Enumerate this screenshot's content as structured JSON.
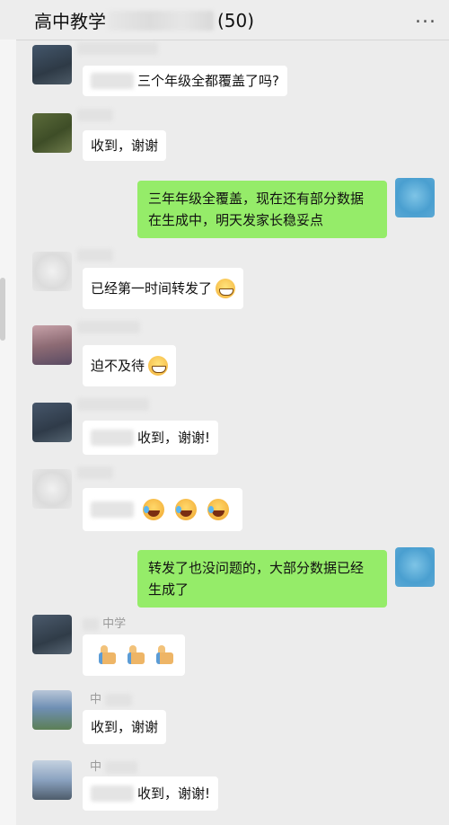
{
  "header": {
    "title_prefix": "高中教学",
    "member_count": "(50)",
    "more_icon": "..."
  },
  "messages": [
    {
      "side": "left",
      "avatar": "avatar-1",
      "text": "三个年级全都覆盖了吗?",
      "blurred_prefix": true
    },
    {
      "side": "left",
      "avatar": "avatar-2",
      "text": "收到，谢谢"
    },
    {
      "side": "right",
      "avatar": "avatar-self",
      "text": "三年年级全覆盖，现在还有部分数据在生成中，明天发家长稳妥点"
    },
    {
      "side": "left",
      "avatar": "avatar-3",
      "text": "已经第一时间转发了",
      "emoji": "grin"
    },
    {
      "side": "left",
      "avatar": "avatar-4",
      "text": "迫不及待",
      "emoji": "grin"
    },
    {
      "side": "left",
      "avatar": "avatar-5",
      "text": "收到，谢谢!",
      "blurred_prefix": true
    },
    {
      "side": "left",
      "avatar": "avatar-6",
      "text": "",
      "blurred_prefix": true,
      "emoji": "laugh x3"
    },
    {
      "side": "right",
      "avatar": "avatar-self",
      "text": "转发了也没问题的，大部分数据已经生成了"
    },
    {
      "side": "left",
      "avatar": "avatar-7",
      "nick": "中学",
      "emoji": "thumbs-up x3"
    },
    {
      "side": "left",
      "avatar": "avatar-8",
      "nick": "中",
      "text": "收到，谢谢"
    },
    {
      "side": "left",
      "avatar": "avatar-9",
      "nick": "中",
      "text": "收到，谢谢!",
      "blurred_prefix": true
    }
  ],
  "colors": {
    "chat_background": "#ececec",
    "incoming_bubble": "#ffffff",
    "outgoing_bubble": "#95ec69",
    "header_background": "#ededed"
  }
}
